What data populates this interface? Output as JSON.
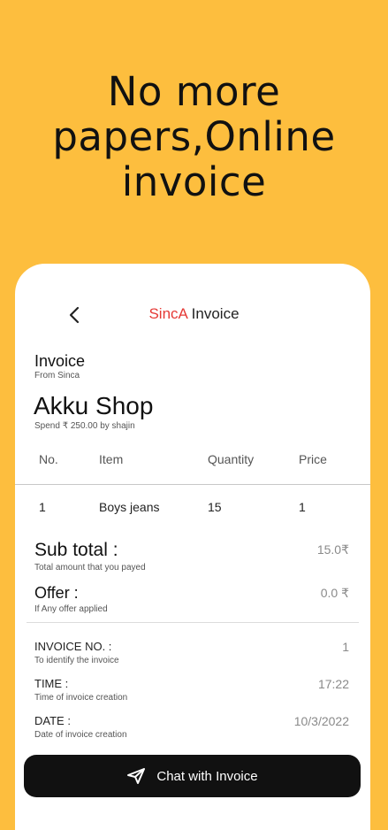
{
  "headline": [
    "No more",
    "papers,Online",
    "invoice"
  ],
  "appbar": {
    "brand": "SincA",
    "title": "Invoice"
  },
  "invoice": {
    "heading": "Invoice",
    "from": "From Sinca",
    "shop": "Akku Shop",
    "spend": "Spend ₹ 250.00 by shajin"
  },
  "table": {
    "headers": [
      "No.",
      "Item",
      "Quantity",
      "Price"
    ],
    "rows": [
      [
        "1",
        "Boys jeans",
        "15",
        "1"
      ]
    ]
  },
  "summary": {
    "subtotal_label": "Sub total :",
    "subtotal_sub": "Total amount that you payed",
    "subtotal_value": "15.0₹",
    "offer_label": "Offer :",
    "offer_sub": "If Any offer applied",
    "offer_value": "0.0 ₹"
  },
  "details": {
    "invoice_no_label": "INVOICE NO. :",
    "invoice_no_sub": "To identify the invoice",
    "invoice_no_value": "1",
    "time_label": "TIME :",
    "time_sub": "Time of invoice creation",
    "time_value": "17:22",
    "date_label": "DATE :",
    "date_sub": "Date of invoice creation",
    "date_value": "10/3/2022"
  },
  "chat_button": "Chat with Invoice"
}
